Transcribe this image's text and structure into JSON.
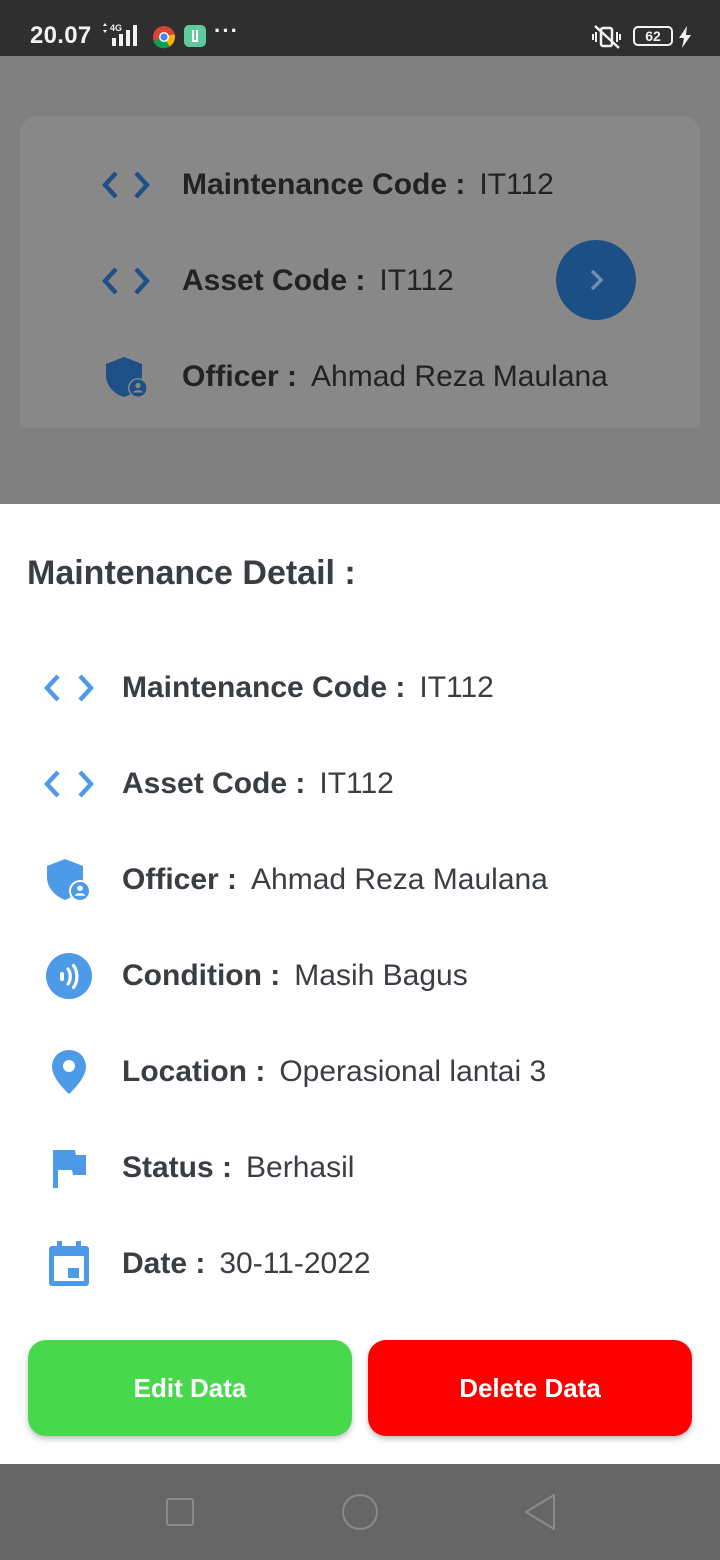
{
  "status_bar": {
    "time": "20.07",
    "network": "4G",
    "battery": "62"
  },
  "background_card": {
    "rows": [
      {
        "label": "Maintenance Code :",
        "value": "IT112",
        "icon": "code-icon"
      },
      {
        "label": "Asset Code :",
        "value": "IT112",
        "icon": "code-icon"
      },
      {
        "label": "Officer :",
        "value": "Ahmad Reza Maulana",
        "icon": "admin-shield-icon"
      }
    ],
    "fab_icon": "chevron-right-icon"
  },
  "sheet": {
    "title": "Maintenance Detail :",
    "rows": [
      {
        "label": "Maintenance Code :",
        "value": "IT112",
        "icon": "code-icon"
      },
      {
        "label": "Asset Code :",
        "value": "IT112",
        "icon": "code-icon"
      },
      {
        "label": "Officer :",
        "value": "Ahmad Reza Maulana",
        "icon": "admin-shield-icon"
      },
      {
        "label": "Condition :",
        "value": "Masih Bagus",
        "icon": "nfc-signal-icon"
      },
      {
        "label": "Location :",
        "value": "Operasional lantai 3",
        "icon": "location-pin-icon"
      },
      {
        "label": "Status :",
        "value": "Berhasil",
        "icon": "flag-icon"
      },
      {
        "label": "Date :",
        "value": "30-11-2022",
        "icon": "calendar-icon"
      }
    ],
    "edit_label": "Edit Data",
    "delete_label": "Delete Data"
  },
  "colors": {
    "accent_blue": "#4d9be8",
    "edit_green": "#48d84c",
    "delete_red": "#ff0000"
  }
}
